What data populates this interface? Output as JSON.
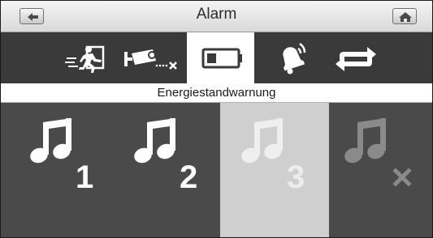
{
  "header": {
    "title": "Alarm",
    "back_icon": "arrow-left-icon",
    "home_icon": "home-icon"
  },
  "tabs": [
    {
      "icon": "motion-alarm-icon",
      "selected": false
    },
    {
      "icon": "camera-disconnected-icon",
      "selected": false
    },
    {
      "icon": "battery-icon",
      "selected": true
    },
    {
      "icon": "bell-ringing-icon",
      "selected": false
    },
    {
      "icon": "repeat-icon",
      "selected": false
    }
  ],
  "subtitle": "Energiestandwarnung",
  "sounds": [
    {
      "icon": "music-note-icon",
      "number": "1",
      "selected": false
    },
    {
      "icon": "music-note-icon",
      "number": "2",
      "selected": false
    },
    {
      "icon": "music-note-icon",
      "number": "3",
      "selected": true
    },
    {
      "icon": "music-note-off-icon",
      "selected": false
    }
  ],
  "colors": {
    "tab_strip": "#3a3a3a",
    "tile": "#4a4a4a",
    "tile_selected": "#cfcfcf",
    "tab_selected": "#ffffff"
  }
}
